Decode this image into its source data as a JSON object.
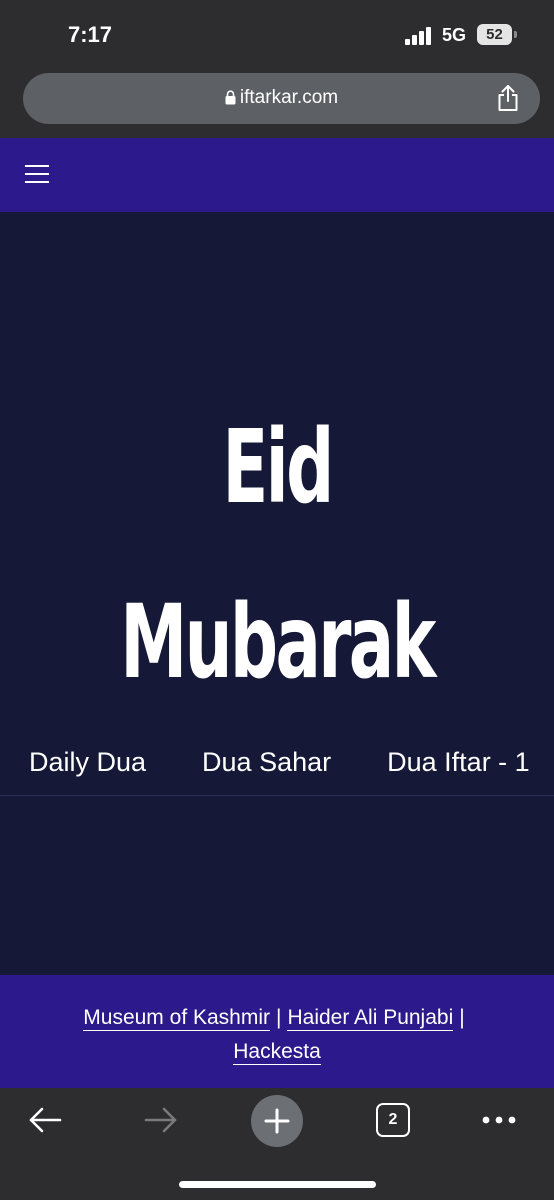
{
  "status_bar": {
    "time": "7:17",
    "network": "5G",
    "battery": "52"
  },
  "browser": {
    "url": "iftarkar.com",
    "tab_count": "2"
  },
  "hero": {
    "line1": "Eid",
    "line2": "Mubarak"
  },
  "nav": {
    "items": [
      "Daily Dua",
      "Dua Sahar",
      "Dua Iftar - 1"
    ]
  },
  "footer": {
    "links": [
      "Museum of Kashmir",
      "Haider Ali Punjabi",
      "Hackesta"
    ],
    "separator": "|"
  },
  "colors": {
    "page_bg": "#151837",
    "header_bg": "#2c1a8c",
    "browser_chrome": "#2d2d2f"
  }
}
